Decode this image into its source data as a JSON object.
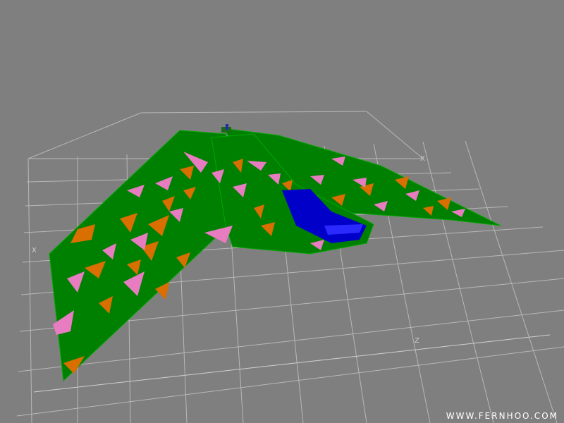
{
  "viewport": {
    "background_color": "#7f7f7f",
    "grid_color": "#b8b8b8",
    "axis_labels": {
      "x_left": "X",
      "x_right": "X",
      "z": "Z"
    }
  },
  "model": {
    "colors": {
      "hull": "#008000",
      "orange_panel": "#d86f00",
      "pink_panel": "#e87cc0",
      "cockpit": "#0000c8",
      "edge": "#00a800"
    }
  },
  "watermark": "WWW.FERNHOO.COM"
}
